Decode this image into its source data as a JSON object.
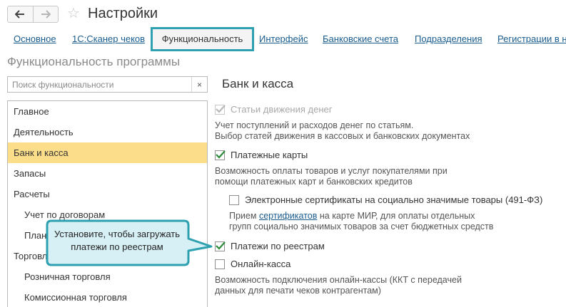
{
  "window": {
    "title": "Настройки"
  },
  "tabs": [
    {
      "label": "Основное"
    },
    {
      "label": "1С:Сканер чеков"
    },
    {
      "label": "Функциональность",
      "active": true
    },
    {
      "label": "Интерфейс"
    },
    {
      "label": "Банковские счета"
    },
    {
      "label": "Подразделения"
    },
    {
      "label": "Регистрации в н"
    }
  ],
  "section_title": "Функциональность программы",
  "search": {
    "placeholder": "Поиск функциональности",
    "value": ""
  },
  "sections_list": [
    {
      "label": "Главное"
    },
    {
      "label": "Деятельность"
    },
    {
      "label": "Банк и касса",
      "selected": true
    },
    {
      "label": "Запасы"
    },
    {
      "label": "Расчеты"
    },
    {
      "label": "Учет по договорам"
    },
    {
      "label": "Плани"
    },
    {
      "label": "Торговля"
    },
    {
      "label": "Розничная торговля"
    },
    {
      "label": "Комиссионная торговля"
    }
  ],
  "panel": {
    "title": "Банк и касса",
    "options": {
      "movement_items": {
        "label": "Статьи движения денег",
        "checked": true,
        "disabled": true,
        "desc1": "Учет поступлений и расходов денег по статьям.",
        "desc2": "Выбор статей движения в кассовых и банковских документах"
      },
      "payment_cards": {
        "label": "Платежные карты",
        "checked": true,
        "desc1": "Возможность оплаты товаров и услуг покупателями при",
        "desc2": "помощи платежных карт и банковских кредитов"
      },
      "e_certificates": {
        "label": "Электронные сертификаты на социально значимые товары (491-ФЗ)",
        "checked": false,
        "desc1_pre": "Прием ",
        "desc1_link": "сертификатов",
        "desc1_post": " на карте МИР, для оплаты отдельных",
        "desc2": "групп социально значимых товаров за счет бюджетных средств"
      },
      "registry_payments": {
        "label": "Платежи по реестрам",
        "checked": true
      },
      "online_cash": {
        "label": "Онлайн-касса",
        "checked": false,
        "desc1": "Возможность подключения онлайн-кассы (ККТ с передачей",
        "desc2": "данных для печати чеков контрагентам)"
      }
    }
  },
  "callout": {
    "line1": "Установите, чтобы загружать",
    "line2": "платежи по реестрам"
  },
  "colors": {
    "accent": "#2ea1b0",
    "selection": "#fbdd8a",
    "link": "#1a5c8e",
    "checkmark": "#2e8b3e"
  },
  "icons": [
    "back-arrow-icon",
    "forward-arrow-icon",
    "star-icon",
    "clear-icon",
    "checkmark-icon"
  ]
}
